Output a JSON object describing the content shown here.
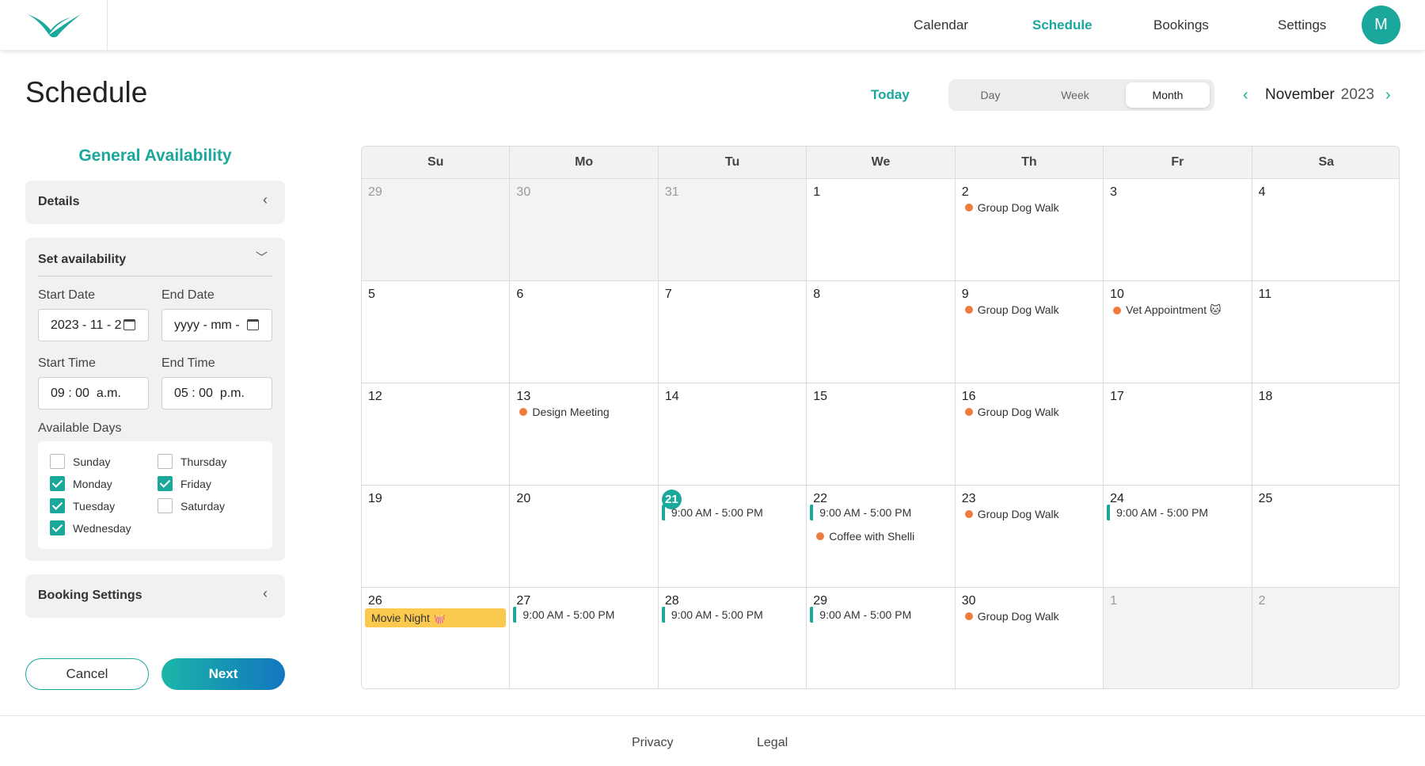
{
  "nav": {
    "items": [
      {
        "label": "Calendar",
        "active": false
      },
      {
        "label": "Schedule",
        "active": true
      },
      {
        "label": "Bookings",
        "active": false
      },
      {
        "label": "Settings",
        "active": false
      }
    ],
    "avatar_initial": "M"
  },
  "page": {
    "title": "Schedule"
  },
  "calendar_controls": {
    "today_label": "Today",
    "views": [
      {
        "label": "Day",
        "active": false
      },
      {
        "label": "Week",
        "active": false
      },
      {
        "label": "Month",
        "active": true
      }
    ],
    "month": "November",
    "year": "2023",
    "prev_icon": "chevron-left-icon",
    "next_icon": "chevron-right-icon"
  },
  "sidebar": {
    "title": "General Availability",
    "details_label": "Details",
    "availability_label": "Set availability",
    "start_date_label": "Start Date",
    "start_date_value": "2023 - 11 - 2",
    "end_date_label": "End Date",
    "end_date_value": "yyyy - mm - d",
    "start_time_label": "Start Time",
    "start_time_value": "09 : 00  a.m.",
    "end_time_label": "End Time",
    "end_time_value": "05 : 00  p.m.",
    "available_days_label": "Available Days",
    "days": [
      {
        "label": "Sunday",
        "checked": false
      },
      {
        "label": "Monday",
        "checked": true
      },
      {
        "label": "Tuesday",
        "checked": true
      },
      {
        "label": "Wednesday",
        "checked": true
      },
      {
        "label": "Thursday",
        "checked": false
      },
      {
        "label": "Friday",
        "checked": true
      },
      {
        "label": "Saturday",
        "checked": false
      }
    ],
    "booking_settings_label": "Booking Settings",
    "cancel_label": "Cancel",
    "next_label": "Next"
  },
  "calendar": {
    "weekdays": [
      "Su",
      "Mo",
      "Tu",
      "We",
      "Th",
      "Fr",
      "Sa"
    ],
    "weeks": [
      [
        {
          "day": "29",
          "other": true,
          "events": []
        },
        {
          "day": "30",
          "other": true,
          "events": []
        },
        {
          "day": "31",
          "other": true,
          "events": []
        },
        {
          "day": "1",
          "events": []
        },
        {
          "day": "2",
          "events": [
            {
              "type": "dot",
              "label": "Group Dog Walk"
            }
          ]
        },
        {
          "day": "3",
          "events": []
        },
        {
          "day": "4",
          "events": []
        }
      ],
      [
        {
          "day": "5",
          "events": []
        },
        {
          "day": "6",
          "events": []
        },
        {
          "day": "7",
          "events": []
        },
        {
          "day": "8",
          "events": []
        },
        {
          "day": "9",
          "events": [
            {
              "type": "dot",
              "label": "Group Dog Walk"
            }
          ]
        },
        {
          "day": "10",
          "events": [
            {
              "type": "dot",
              "label": "Vet Appointment 🐱"
            }
          ]
        },
        {
          "day": "11",
          "events": []
        }
      ],
      [
        {
          "day": "12",
          "events": []
        },
        {
          "day": "13",
          "events": [
            {
              "type": "dot",
              "label": "Design Meeting"
            }
          ]
        },
        {
          "day": "14",
          "events": []
        },
        {
          "day": "15",
          "events": []
        },
        {
          "day": "16",
          "events": [
            {
              "type": "dot",
              "label": "Group Dog Walk"
            }
          ]
        },
        {
          "day": "17",
          "events": []
        },
        {
          "day": "18",
          "events": []
        }
      ],
      [
        {
          "day": "19",
          "events": []
        },
        {
          "day": "20",
          "events": []
        },
        {
          "day": "21",
          "today": true,
          "events": [
            {
              "type": "avail",
              "label": "9:00 AM - 5:00 PM"
            }
          ]
        },
        {
          "day": "22",
          "events": [
            {
              "type": "avail",
              "label": "9:00 AM - 5:00 PM"
            },
            {
              "type": "dot",
              "label": "Coffee with Shelli"
            }
          ]
        },
        {
          "day": "23",
          "events": [
            {
              "type": "dot",
              "label": "Group Dog Walk"
            }
          ]
        },
        {
          "day": "24",
          "events": [
            {
              "type": "avail",
              "label": "9:00 AM - 5:00 PM"
            }
          ]
        },
        {
          "day": "25",
          "events": []
        }
      ],
      [
        {
          "day": "26",
          "events": [
            {
              "type": "allday",
              "label": "Movie Night 🍿"
            }
          ]
        },
        {
          "day": "27",
          "events": [
            {
              "type": "avail",
              "label": "9:00 AM - 5:00 PM"
            }
          ]
        },
        {
          "day": "28",
          "events": [
            {
              "type": "avail",
              "label": "9:00 AM - 5:00 PM"
            }
          ]
        },
        {
          "day": "29",
          "events": [
            {
              "type": "avail",
              "label": "9:00 AM - 5:00 PM"
            }
          ]
        },
        {
          "day": "30",
          "events": [
            {
              "type": "dot",
              "label": "Group Dog Walk"
            }
          ]
        },
        {
          "day": "1",
          "other": true,
          "events": []
        },
        {
          "day": "2",
          "other": true,
          "events": []
        }
      ]
    ]
  },
  "footer": {
    "links": [
      "Privacy",
      "Legal"
    ]
  },
  "colors": {
    "accent": "#1aa89c",
    "event_dot": "#f07b3f",
    "all_day": "#fbc94d"
  }
}
